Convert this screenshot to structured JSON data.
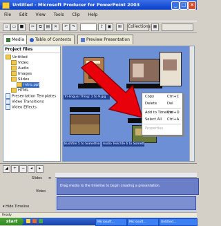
{
  "window": {
    "title": "Untitled - Microsoft Producer for PowerPoint 2003"
  },
  "menu": [
    "File",
    "Edit",
    "View",
    "Tools",
    "Clip",
    "Help"
  ],
  "toolbar": {
    "collections_label": "Collections",
    "dropdown_value": ""
  },
  "tabs": [
    {
      "label": "Media"
    },
    {
      "label": "Table of Contents"
    },
    {
      "label": "Preview Presentation"
    }
  ],
  "project_files": {
    "title": "Project files",
    "items": [
      {
        "label": "Untitled",
        "type": "folder"
      },
      {
        "label": "Video",
        "type": "folder"
      },
      {
        "label": "Audio",
        "type": "folder"
      },
      {
        "label": "Images",
        "type": "folder"
      },
      {
        "label": "Slides",
        "type": "folder"
      },
      {
        "label": "intro.ppt",
        "type": "file"
      },
      {
        "label": "HTML",
        "type": "folder"
      },
      {
        "label": "Presentation Templates",
        "type": "file"
      },
      {
        "label": "Video Transitions",
        "type": "file"
      },
      {
        "label": "Video Effects",
        "type": "file"
      }
    ]
  },
  "thumbnails": {
    "selected_label_1": "Tri-lingual Thing: 2 to 9.jpg",
    "selected_label_2": "Bushfire 5 to Something.jpg",
    "selected_label_3": "Audio TeAchTe 6 to Something.jpg"
  },
  "context_menu": {
    "items": [
      {
        "label": "Copy",
        "shortcut": "Ctrl+C",
        "disabled": false
      },
      {
        "label": "Delete",
        "shortcut": "Del",
        "disabled": false
      },
      {
        "label": "Add to Timeline",
        "shortcut": "Ctrl+D",
        "disabled": false
      },
      {
        "label": "Select All",
        "shortcut": "Ctrl+A",
        "disabled": false
      },
      {
        "label": "Properties",
        "shortcut": "",
        "disabled": true
      }
    ]
  },
  "timeline": {
    "tracks": [
      {
        "label": "Slides"
      },
      {
        "label": "Video"
      }
    ],
    "clip_text": "Drag media to the timeline to begin creating a presentation.",
    "hide_label": "Hide Timeline"
  },
  "statusbar": {
    "text": "Ready"
  },
  "taskbar": {
    "start_label": "start",
    "tasks": [
      "Microsoft...",
      "Microsoft...",
      "Untitled..."
    ]
  },
  "colors": {
    "accent": "#316ac5",
    "arrow": "#e8000a",
    "timeline_clip": "#6a7fc8"
  }
}
